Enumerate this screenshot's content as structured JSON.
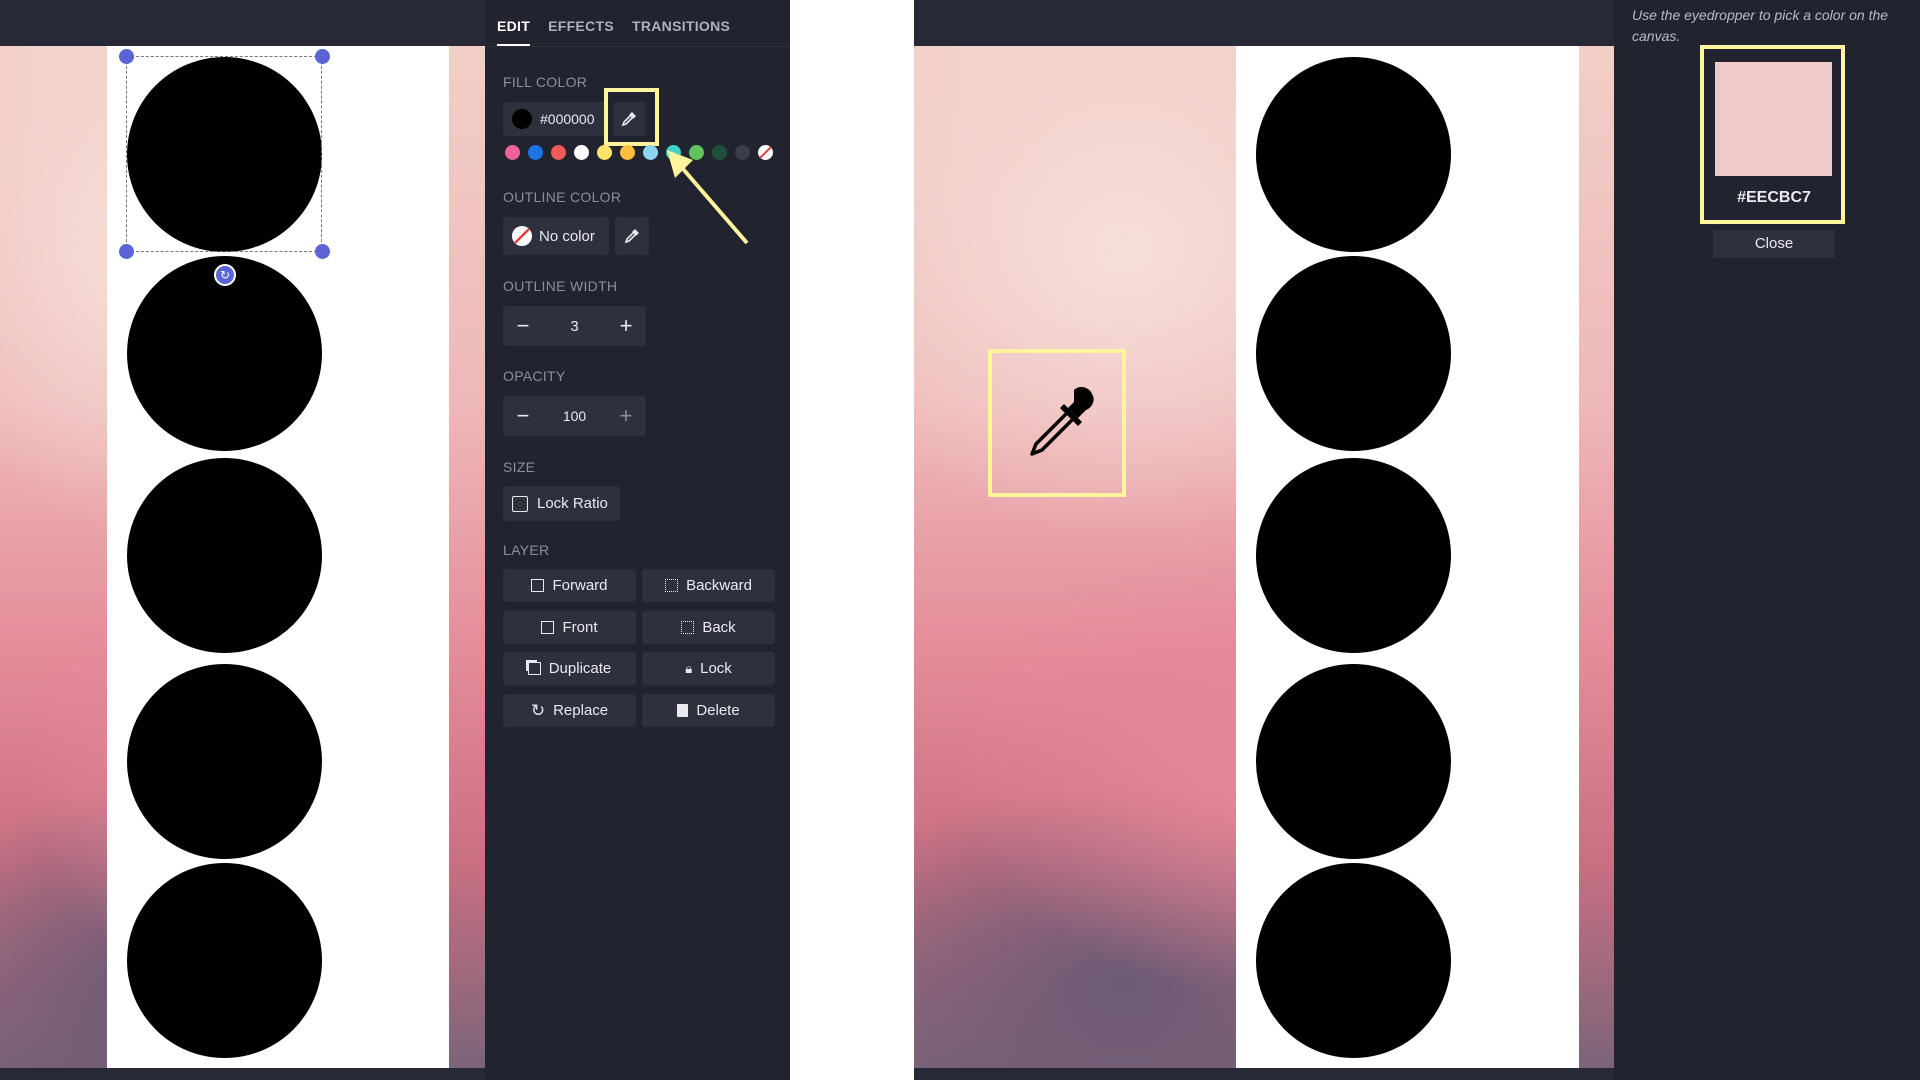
{
  "tabs": [
    {
      "label": "EDIT",
      "active": true
    },
    {
      "label": "EFFECTS",
      "active": false
    },
    {
      "label": "TRANSITIONS",
      "active": false
    }
  ],
  "fill": {
    "label": "FILL COLOR",
    "value": "#000000",
    "swatches": [
      "#f0639a",
      "#1e74e6",
      "#ef5a5a",
      "#ffffff",
      "#ffe36b",
      "#ffbf3a",
      "#8ed3f2",
      "#3fd2c7",
      "#5fc25d",
      "#1f4f3d",
      "#3a3d4a",
      "none"
    ]
  },
  "outline_color": {
    "label": "OUTLINE COLOR",
    "value": "No color"
  },
  "outline_width": {
    "label": "OUTLINE WIDTH",
    "value": "3"
  },
  "opacity": {
    "label": "OPACITY",
    "value": "100"
  },
  "size": {
    "label": "SIZE",
    "lock_ratio": "Lock Ratio"
  },
  "layer": {
    "label": "LAYER",
    "buttons": [
      {
        "label": "Forward",
        "icon": "bring-forward-icon"
      },
      {
        "label": "Backward",
        "icon": "send-backward-icon"
      },
      {
        "label": "Front",
        "icon": "bring-to-front-icon"
      },
      {
        "label": "Back",
        "icon": "send-to-back-icon"
      },
      {
        "label": "Duplicate",
        "icon": "duplicate-icon"
      },
      {
        "label": "Lock",
        "icon": "lock-icon"
      },
      {
        "label": "Replace",
        "icon": "replace-icon"
      },
      {
        "label": "Delete",
        "icon": "trash-icon"
      }
    ]
  },
  "picker": {
    "hint": "Use the eyedropper to pick a color on the canvas.",
    "color": "#EECBC7",
    "close": "Close"
  },
  "colors": {
    "highlight": "#fff59e",
    "selection": "#5b64d6",
    "panel_bg": "#21232e",
    "shape_fill": "#000000"
  }
}
